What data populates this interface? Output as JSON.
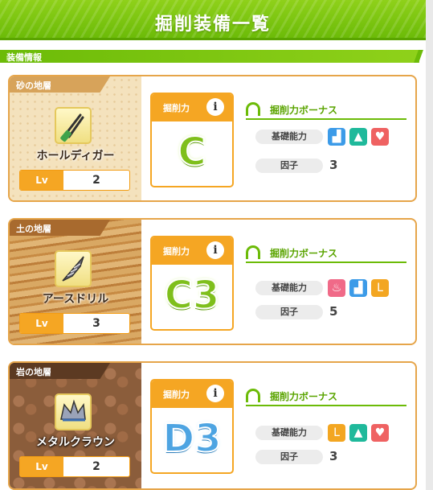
{
  "header": {
    "title": "掘削装備一覧"
  },
  "section": {
    "label": "装備情報"
  },
  "cards": [
    {
      "stratum": "砂の地層",
      "equipment": "ホールディガー",
      "equipment_icon": "tongs-icon",
      "lv_label": "Lv",
      "lv": "2",
      "dig_label": "掘削力",
      "grade": "C",
      "bonus_title": "掘削力ボーナス",
      "basic_label": "基礎能力",
      "factor_label": "因子",
      "factor_value": "3",
      "basic_badges": [
        "boot-icon",
        "graduation-cap-icon",
        "heart-icon"
      ]
    },
    {
      "stratum": "土の地層",
      "equipment": "アースドリル",
      "equipment_icon": "drill-icon",
      "lv_label": "Lv",
      "lv": "3",
      "dig_label": "掘削力",
      "grade": "C3",
      "bonus_title": "掘削力ボーナス",
      "basic_label": "基礎能力",
      "factor_label": "因子",
      "factor_value": "5",
      "basic_badges": [
        "flame-icon",
        "boot-icon",
        "muscle-icon"
      ]
    },
    {
      "stratum": "岩の地層",
      "equipment": "メタルクラウン",
      "equipment_icon": "crown-icon",
      "lv_label": "Lv",
      "lv": "2",
      "dig_label": "掘削力",
      "grade": "D3",
      "bonus_title": "掘削力ボーナス",
      "basic_label": "基礎能力",
      "factor_label": "因子",
      "factor_value": "3",
      "basic_badges": [
        "muscle-icon",
        "graduation-cap-icon",
        "heart-icon"
      ]
    }
  ],
  "colors": {
    "accent_green": "#6cbb08",
    "accent_orange": "#f5a623",
    "grade_c": "#7fbf1c",
    "grade_d": "#4da4e2"
  }
}
